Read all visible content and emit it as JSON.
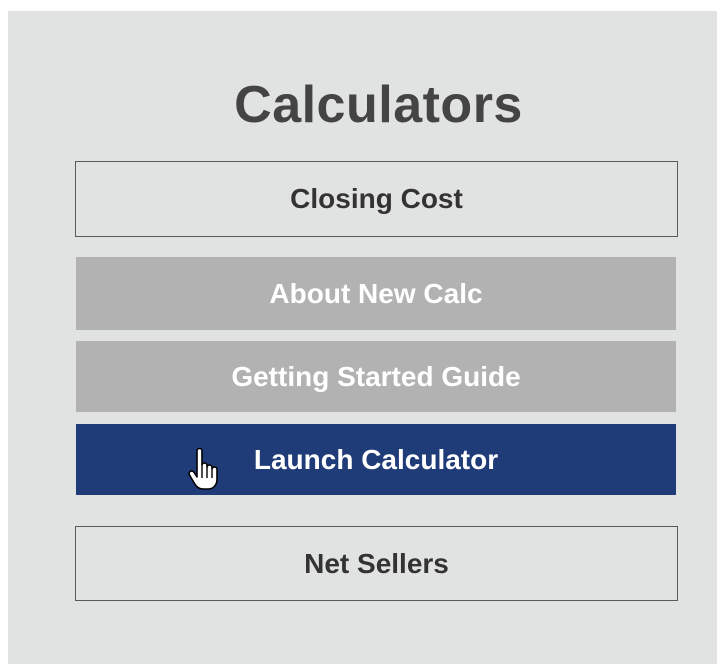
{
  "panel": {
    "title": "Calculators",
    "buttons": {
      "closing_cost": "Closing Cost",
      "about_new_calc": "About New Calc",
      "getting_started_guide": "Getting Started Guide",
      "launch_calculator": "Launch Calculator",
      "net_sellers": "Net Sellers"
    }
  },
  "colors": {
    "panel_background": "#e1e2e2",
    "gray_button": "#b1b2b1",
    "accent_blue": "#1f3b78",
    "title_text": "#444444"
  },
  "cursor": {
    "icon": "hand-pointer-icon"
  }
}
